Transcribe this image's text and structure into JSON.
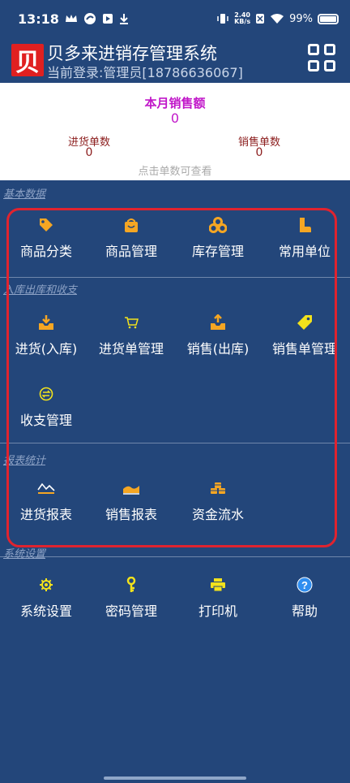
{
  "status_bar": {
    "time": "13:18",
    "speed_value": "2.40",
    "speed_unit": "KB/s",
    "battery": "99%"
  },
  "app": {
    "logo_char": "贝",
    "title": "贝多来进销存管理系统",
    "user_line": "当前登录:管理员[18786636067]"
  },
  "summary": {
    "month_sales_label": "本月销售额",
    "month_sales_value": "0",
    "purchase_count_label": "进货单数",
    "purchase_count_value": "0",
    "sales_count_label": "销售单数",
    "sales_count_value": "0",
    "hint": "点击单数可查看"
  },
  "sections": {
    "basic": {
      "title": "基本数据",
      "items": [
        {
          "label": "商品分类",
          "icon": "tag-icon"
        },
        {
          "label": "商品管理",
          "icon": "shopping-bag-icon"
        },
        {
          "label": "库存管理",
          "icon": "boxes-icon"
        },
        {
          "label": "常用单位",
          "icon": "boot-icon"
        }
      ]
    },
    "inout": {
      "title": "入库出库和收支",
      "items": [
        {
          "label": "进货(入库)",
          "icon": "inbox-in-icon"
        },
        {
          "label": "进货单管理",
          "icon": "cart-icon"
        },
        {
          "label": "销售(出库)",
          "icon": "inbox-out-icon"
        },
        {
          "label": "销售单管理",
          "icon": "price-tag-icon"
        },
        {
          "label": "收支管理",
          "icon": "exchange-icon"
        }
      ]
    },
    "reports": {
      "title": "报表统计",
      "items": [
        {
          "label": "进货报表",
          "icon": "line-chart-icon"
        },
        {
          "label": "销售报表",
          "icon": "area-chart-icon"
        },
        {
          "label": "资金流水",
          "icon": "coins-icon"
        }
      ]
    },
    "settings": {
      "title": "系统设置",
      "items": [
        {
          "label": "系统设置",
          "icon": "gear-icon"
        },
        {
          "label": "密码管理",
          "icon": "key-icon"
        },
        {
          "label": "打印机",
          "icon": "printer-icon"
        },
        {
          "label": "帮助",
          "icon": "help-icon"
        }
      ]
    }
  },
  "colors": {
    "background": "#23467a",
    "icon_orange": "#f5a623",
    "icon_yellow": "#f2e21c",
    "icon_blue": "#2f8ef0",
    "sales_magenta": "#c117c9",
    "count_red": "#8b1c1c",
    "highlight_box": "#e0232f"
  }
}
